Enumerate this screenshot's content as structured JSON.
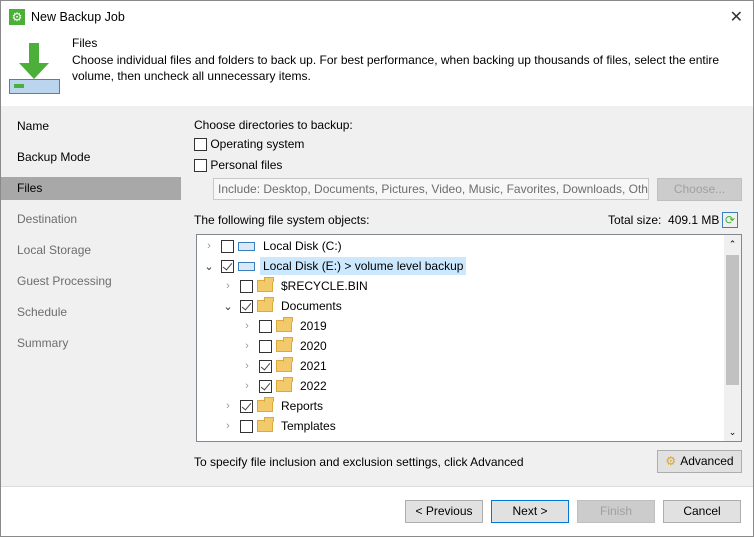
{
  "window": {
    "title": "New Backup Job",
    "close": "✕"
  },
  "header": {
    "title": "Files",
    "description": "Choose individual files and folders to back up. For best performance, when backing up thousands of files, select the entire volume, then uncheck all unnecessary items."
  },
  "sidebar": {
    "items": [
      {
        "label": "Name"
      },
      {
        "label": "Backup Mode"
      },
      {
        "label": "Files"
      },
      {
        "label": "Destination"
      },
      {
        "label": "Local Storage"
      },
      {
        "label": "Guest Processing"
      },
      {
        "label": "Schedule"
      },
      {
        "label": "Summary"
      }
    ]
  },
  "main": {
    "choose_label": "Choose directories to backup:",
    "os_label": "Operating system",
    "personal_label": "Personal files",
    "include_value": "Include: Desktop, Documents, Pictures, Video, Music, Favorites, Downloads, Other",
    "choose_button": "Choose...",
    "objects_label": "The following file system objects:",
    "total_size_label": "Total size:",
    "total_size_value": "409.1 MB",
    "tree": [
      {
        "label": "Local Disk (C:)",
        "checked": false,
        "expanded": false,
        "level": 0,
        "icon": "windows-disk"
      },
      {
        "label": "Local Disk (E:) > volume level backup",
        "checked": true,
        "expanded": true,
        "level": 0,
        "icon": "disk"
      },
      {
        "label": "$RECYCLE.BIN",
        "checked": false,
        "expanded": false,
        "level": 1,
        "icon": "folder"
      },
      {
        "label": "Documents",
        "checked": true,
        "expanded": true,
        "level": 1,
        "icon": "folder-open"
      },
      {
        "label": "2019",
        "checked": false,
        "expanded": false,
        "level": 2,
        "icon": "folder"
      },
      {
        "label": "2020",
        "checked": false,
        "expanded": false,
        "level": 2,
        "icon": "folder"
      },
      {
        "label": "2021",
        "checked": true,
        "expanded": false,
        "level": 2,
        "icon": "folder"
      },
      {
        "label": "2022",
        "checked": true,
        "expanded": false,
        "level": 2,
        "icon": "folder"
      },
      {
        "label": "Reports",
        "checked": true,
        "expanded": false,
        "level": 1,
        "icon": "folder"
      },
      {
        "label": "Templates",
        "checked": false,
        "expanded": false,
        "level": 1,
        "icon": "folder"
      }
    ],
    "advanced_hint": "To specify file inclusion and exclusion settings, click Advanced",
    "advanced_button": "Advanced"
  },
  "footer": {
    "previous": "< Previous",
    "next": "Next >",
    "finish": "Finish",
    "cancel": "Cancel"
  }
}
